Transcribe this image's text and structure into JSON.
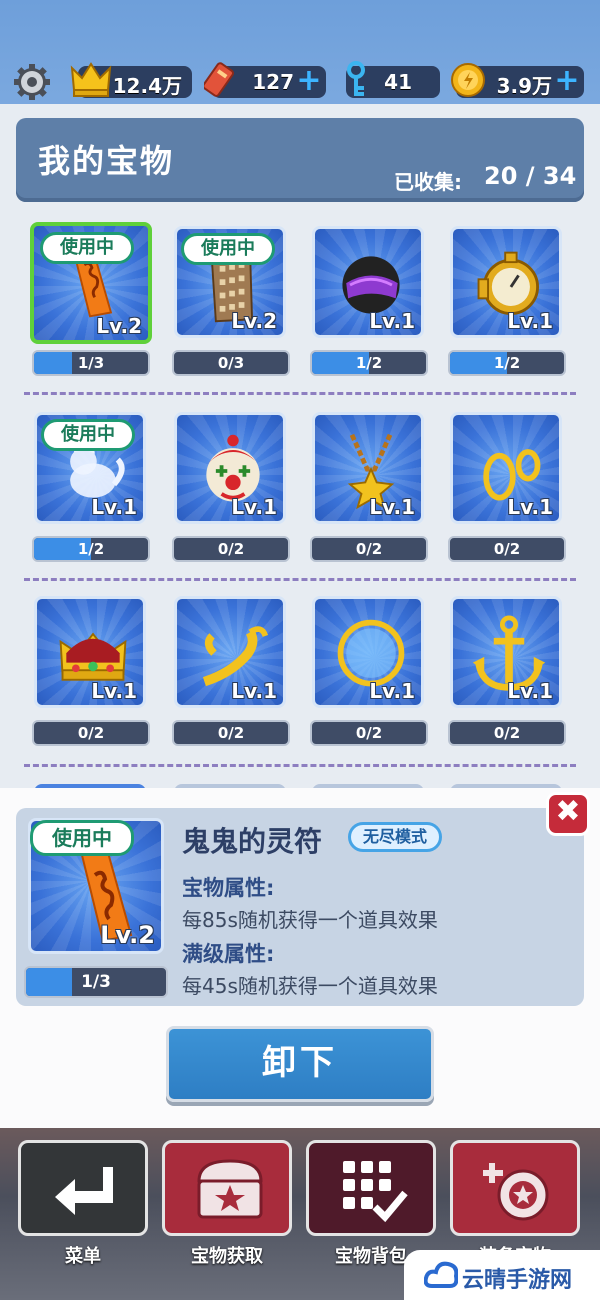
{
  "topbar": {
    "crown": "12.4万",
    "ticket": "127",
    "key": "41",
    "coin": "3.9万"
  },
  "header": {
    "title": "我的宝物",
    "collected_label": "已收集:",
    "collected_value": "20 / 34"
  },
  "items": [
    {
      "lv": "Lv.2",
      "progress": "1/3",
      "fill": 0.33,
      "in_use": true,
      "icon": "talisman-icon"
    },
    {
      "lv": "Lv.2",
      "progress": "0/3",
      "fill": 0,
      "in_use": true,
      "icon": "building-icon"
    },
    {
      "lv": "Lv.1",
      "progress": "1/2",
      "fill": 0.5,
      "in_use": false,
      "icon": "helmet-icon"
    },
    {
      "lv": "Lv.1",
      "progress": "1/2",
      "fill": 0.5,
      "in_use": false,
      "icon": "stopwatch-icon"
    },
    {
      "lv": "Lv.1",
      "progress": "1/2",
      "fill": 0.5,
      "in_use": true,
      "icon": "ghost-cat-icon"
    },
    {
      "lv": "Lv.1",
      "progress": "0/2",
      "fill": 0,
      "in_use": false,
      "icon": "clown-icon"
    },
    {
      "lv": "Lv.1",
      "progress": "0/2",
      "fill": 0,
      "in_use": false,
      "icon": "star-necklace-icon"
    },
    {
      "lv": "Lv.1",
      "progress": "0/2",
      "fill": 0,
      "in_use": false,
      "icon": "earrings-icon"
    },
    {
      "lv": "Lv.1",
      "progress": "0/2",
      "fill": 0,
      "in_use": false,
      "icon": "crown-icon"
    },
    {
      "lv": "Lv.1",
      "progress": "0/2",
      "fill": 0,
      "in_use": false,
      "icon": "horn-icon"
    },
    {
      "lv": "Lv.1",
      "progress": "0/2",
      "fill": 0,
      "in_use": false,
      "icon": "ring-icon"
    },
    {
      "lv": "Lv.1",
      "progress": "0/2",
      "fill": 0,
      "in_use": false,
      "icon": "anchor-icon"
    }
  ],
  "in_use_label": "使用中",
  "detail": {
    "name": "鬼鬼的灵符",
    "mode": "无尽模式",
    "lv": "Lv.2",
    "progress": "1/3",
    "fill": 0.33,
    "attr_label": "宝物属性:",
    "attr_text": "每85s随机获得一个道具效果",
    "max_label": "满级属性:",
    "max_text": "每45s随机获得一个道具效果",
    "close": "✖"
  },
  "unequip_label": "卸下",
  "nav": {
    "menu": "菜单",
    "get": "宝物获取",
    "bag": "宝物背包",
    "equip": "装备宝物"
  },
  "watermark": "云晴手游网",
  "colors": {
    "accent_green": "#5fd03a",
    "button_blue": "#2e7ec4",
    "nav_red": "#a82c3c"
  }
}
